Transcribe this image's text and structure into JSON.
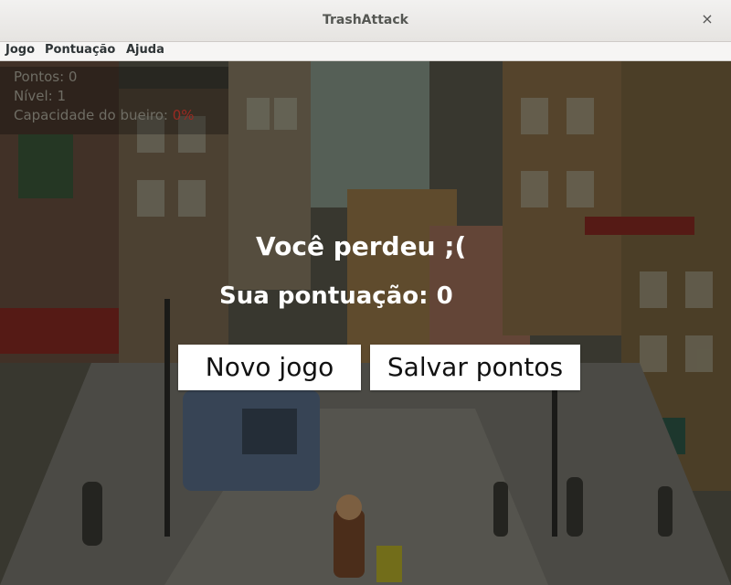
{
  "window": {
    "title": "TrashAttack",
    "close_glyph": "×"
  },
  "menu": {
    "items": [
      "Jogo",
      "Pontuação",
      "Ajuda"
    ]
  },
  "hud": {
    "points_label": "Pontos: 0",
    "level_label": "Nível: 1",
    "capacity_label": "Capacidade do bueiro:",
    "capacity_value": "0%"
  },
  "game_over": {
    "message": "Você perdeu ;(",
    "score_text": "Sua pontuação: 0",
    "new_game_label": "Novo jogo",
    "save_label": "Salvar pontos"
  },
  "colors": {
    "hud_text": "#6f6d64",
    "capacity_value": "#9a2a22",
    "overlay_text": "#ffffff"
  }
}
